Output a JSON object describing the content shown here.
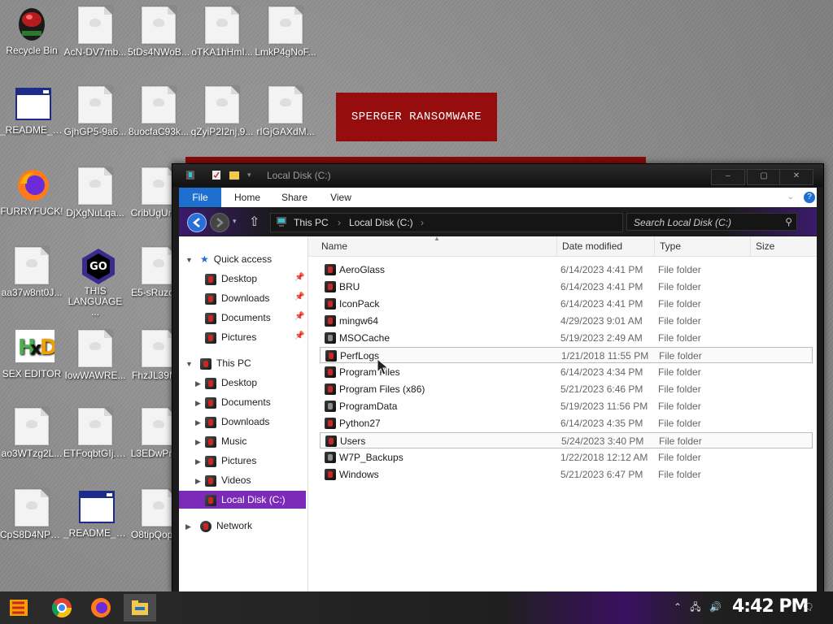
{
  "desktop": {
    "icons": [
      {
        "label": "Recycle Bin",
        "icon": "recycle-bin-icon"
      },
      {
        "label": "AcN-DV7mb...",
        "icon": "file-icon"
      },
      {
        "label": "5tDs4NWoB...",
        "icon": "file-icon"
      },
      {
        "label": "oTKA1hHmI...",
        "icon": "file-icon"
      },
      {
        "label": "LmkP4gNoF...",
        "icon": "file-icon"
      },
      {
        "label": "_README_5...",
        "icon": "readme-icon"
      },
      {
        "label": "GjhGP5-9a6...",
        "icon": "file-icon"
      },
      {
        "label": "8uocfaC93k...",
        "icon": "file-icon"
      },
      {
        "label": "qZyiP2I2nj,9...",
        "icon": "file-icon"
      },
      {
        "label": "rIGjGAXdM...",
        "icon": "file-icon"
      },
      {
        "label": "FURRYFUCK!",
        "icon": "firefox-icon"
      },
      {
        "label": "DjXgNuLqa...",
        "icon": "file-icon"
      },
      {
        "label": "CribUgUrH...",
        "icon": "file-icon"
      },
      {
        "label": "aa37w8nt0J...",
        "icon": "file-icon"
      },
      {
        "label": "THIS LANGUAGE ...",
        "icon": "go-language-icon"
      },
      {
        "label": "E5-sRuzoy...",
        "icon": "file-icon"
      },
      {
        "label": "SEX EDITOR",
        "icon": "hxd-editor-icon"
      },
      {
        "label": "IowWAWRE...",
        "icon": "file-icon"
      },
      {
        "label": "FhzJL39M...",
        "icon": "file-icon"
      },
      {
        "label": "ao3WTzg2L...",
        "icon": "file-icon"
      },
      {
        "label": "ETFoqbtGIj.9...",
        "icon": "file-icon"
      },
      {
        "label": "L3EDwPnv...",
        "icon": "file-icon"
      },
      {
        "label": "CpS8D4NPn...",
        "icon": "file-icon"
      },
      {
        "label": "_README_9...",
        "icon": "readme-icon"
      },
      {
        "label": "O8tipQopa...",
        "icon": "file-icon"
      }
    ],
    "ransom_banner": "SPERGER RANSOMWARE"
  },
  "window": {
    "title": "Local Disk (C:)",
    "controls": {
      "minimize": "–",
      "maximize": "▢",
      "close": "✕"
    }
  },
  "ribbon": {
    "tabs": [
      "File",
      "Home",
      "Share",
      "View"
    ],
    "help": "?"
  },
  "address": {
    "crumbs": [
      "This PC",
      "Local Disk (C:)"
    ],
    "search_placeholder": "Search Local Disk (C:)"
  },
  "nav": {
    "quick_access": "Quick access",
    "quick_items": [
      "Desktop",
      "Downloads",
      "Documents",
      "Pictures"
    ],
    "this_pc": "This PC",
    "pc_items": [
      "Desktop",
      "Documents",
      "Downloads",
      "Music",
      "Pictures",
      "Videos",
      "Local Disk (C:)"
    ],
    "network": "Network"
  },
  "columns": {
    "name": "Name",
    "date": "Date modified",
    "type": "Type",
    "size": "Size"
  },
  "files": [
    {
      "name": "AeroGlass",
      "date": "6/14/2023 4:41 PM",
      "type": "File folder"
    },
    {
      "name": "BRU",
      "date": "6/14/2023 4:41 PM",
      "type": "File folder"
    },
    {
      "name": "IconPack",
      "date": "6/14/2023 4:41 PM",
      "type": "File folder"
    },
    {
      "name": "mingw64",
      "date": "4/29/2023 9:01 AM",
      "type": "File folder"
    },
    {
      "name": "MSOCache",
      "date": "5/19/2023 2:49 AM",
      "type": "File folder"
    },
    {
      "name": "PerfLogs",
      "date": "1/21/2018 11:55 PM",
      "type": "File folder"
    },
    {
      "name": "Program Files",
      "date": "6/14/2023 4:34 PM",
      "type": "File folder"
    },
    {
      "name": "Program Files (x86)",
      "date": "5/21/2023 6:46 PM",
      "type": "File folder"
    },
    {
      "name": "ProgramData",
      "date": "5/19/2023 11:56 PM",
      "type": "File folder"
    },
    {
      "name": "Python27",
      "date": "6/14/2023 4:35 PM",
      "type": "File folder"
    },
    {
      "name": "Users",
      "date": "5/24/2023 3:40 PM",
      "type": "File folder"
    },
    {
      "name": "W7P_Backups",
      "date": "1/22/2018 12:12 AM",
      "type": "File folder"
    },
    {
      "name": "Windows",
      "date": "5/21/2023 6:47 PM",
      "type": "File folder"
    }
  ],
  "taskbar": {
    "pinned": [
      "start-icon",
      "chrome-icon",
      "firefox-icon",
      "file-explorer-icon"
    ],
    "clock": "4:42 PM"
  },
  "colors": {
    "accent": "#7b2bb8",
    "ransom": "#950d0d",
    "file_tab": "#1f6fd1"
  }
}
